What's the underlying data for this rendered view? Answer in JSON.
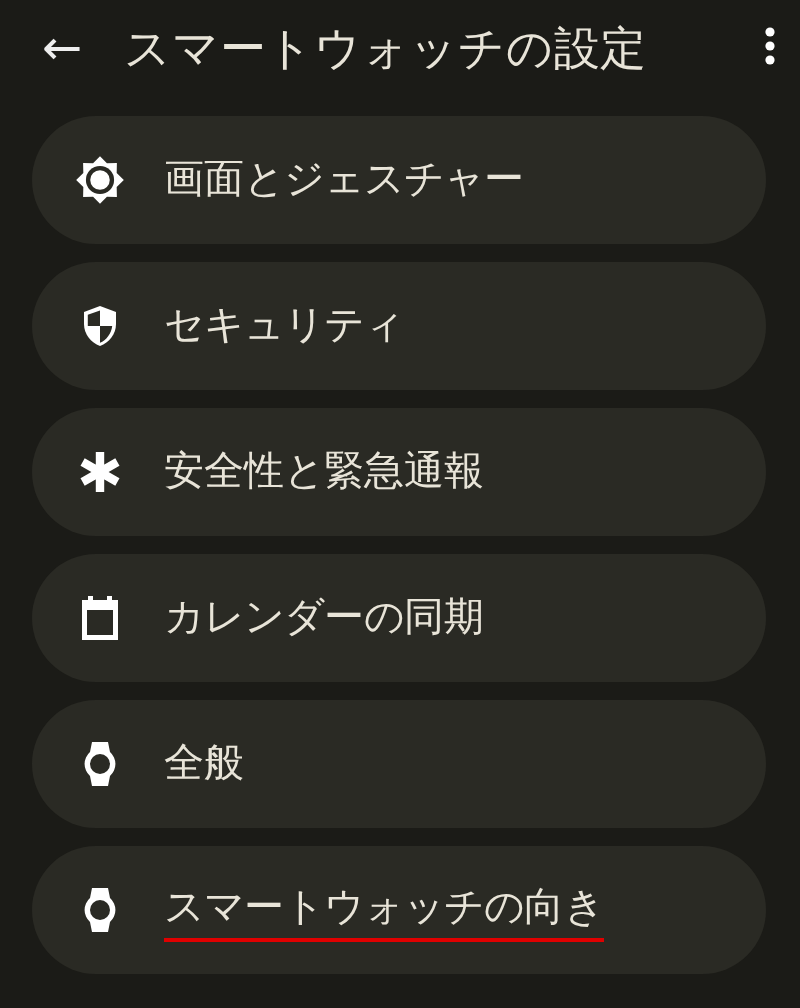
{
  "app_bar": {
    "back_icon": "←",
    "title": "スマートウォッチの設定"
  },
  "items": [
    {
      "label": "画面とジェスチャー",
      "underlined": false
    },
    {
      "label": "セキュリティ",
      "underlined": false
    },
    {
      "label": "安全性と緊急通報",
      "underlined": false
    },
    {
      "label": "カレンダーの同期",
      "underlined": false
    },
    {
      "label": "全般",
      "underlined": false
    },
    {
      "label": "スマートウォッチの向き",
      "underlined": true
    }
  ]
}
